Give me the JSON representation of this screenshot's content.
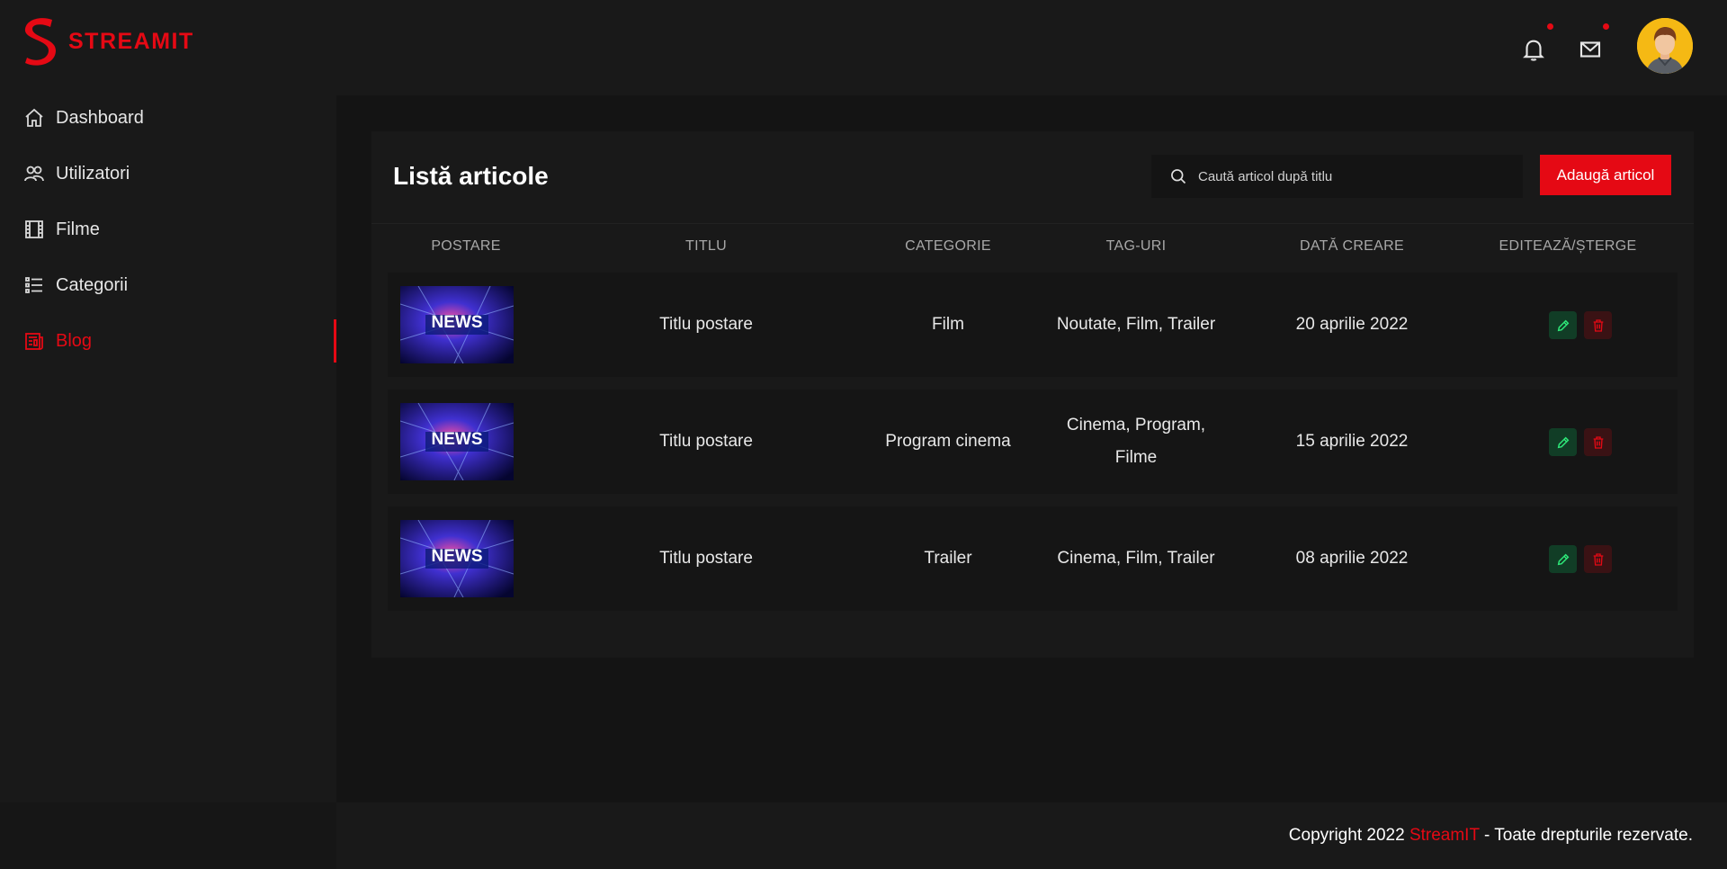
{
  "brand": {
    "name": "STREAMIT",
    "accent": "#e50914"
  },
  "sidebar": {
    "items": [
      {
        "label": "Dashboard",
        "icon": "home-icon",
        "active": false
      },
      {
        "label": "Utilizatori",
        "icon": "users-icon",
        "active": false
      },
      {
        "label": "Filme",
        "icon": "film-icon",
        "active": false
      },
      {
        "label": "Categorii",
        "icon": "list-icon",
        "active": false
      },
      {
        "label": "Blog",
        "icon": "blog-icon",
        "active": true
      }
    ]
  },
  "header": {
    "notifications_icon": "bell-icon",
    "messages_icon": "mail-icon",
    "avatar_icon": "user-avatar-icon"
  },
  "card": {
    "title": "Listă articole",
    "search": {
      "placeholder": "Caută articol după titlu",
      "value": ""
    },
    "add_button": "Adaugă articol",
    "columns": [
      "POSTARE",
      "TITLU",
      "CATEGORIE",
      "TAG-URI",
      "DATĂ CREARE",
      "EDITEAZĂ/ȘTERGE"
    ],
    "rows": [
      {
        "image_text": "NEWS",
        "title": "Titlu postare",
        "category": "Film",
        "tags": "Noutate, Film, Trailer",
        "date": "20 aprilie 2022"
      },
      {
        "image_text": "NEWS",
        "title": "Titlu postare",
        "category": "Program cinema",
        "tags": "Cinema, Program, Filme",
        "date": "15 aprilie 2022"
      },
      {
        "image_text": "NEWS",
        "title": "Titlu postare",
        "category": "Trailer",
        "tags": "Cinema, Film, Trailer",
        "date": "08 aprilie 2022"
      }
    ]
  },
  "footer": {
    "prefix": "Copyright 2022 ",
    "brand": "StreamIT",
    "suffix": " - Toate drepturile rezervate."
  }
}
